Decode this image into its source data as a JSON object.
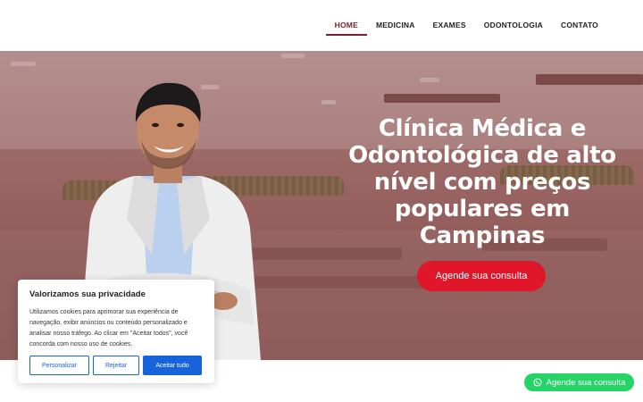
{
  "nav": {
    "items": [
      {
        "label": "HOME",
        "active": true
      },
      {
        "label": "MEDICINA",
        "active": false
      },
      {
        "label": "EXAMES",
        "active": false
      },
      {
        "label": "ODONTOLOGIA",
        "active": false
      },
      {
        "label": "CONTATO",
        "active": false
      }
    ]
  },
  "hero": {
    "title": "Clínica Médica e Odontológica de alto nível com preços populares em Campinas",
    "cta_label": "Agende sua consulta"
  },
  "cookie_banner": {
    "title": "Valorizamos sua privacidade",
    "text": "Utilizamos cookies para aprimorar sua experiência de navegação, exibir anúncios ou conteúdo personalizado e analisar nosso tráfego. Ao clicar em \"Aceitar todos\", você concorda com nosso uso de cookies.",
    "customize_label": "Personalizar",
    "reject_label": "Rejeitar",
    "accept_label": "Aceitar tudo"
  },
  "whatsapp": {
    "label": "Agende sua consulta",
    "icon": "whatsapp-icon"
  },
  "colors": {
    "nav_active": "#7a1f2b",
    "cta": "#e0162b",
    "cookie_accent": "#1863dc",
    "whatsapp": "#25d366"
  }
}
